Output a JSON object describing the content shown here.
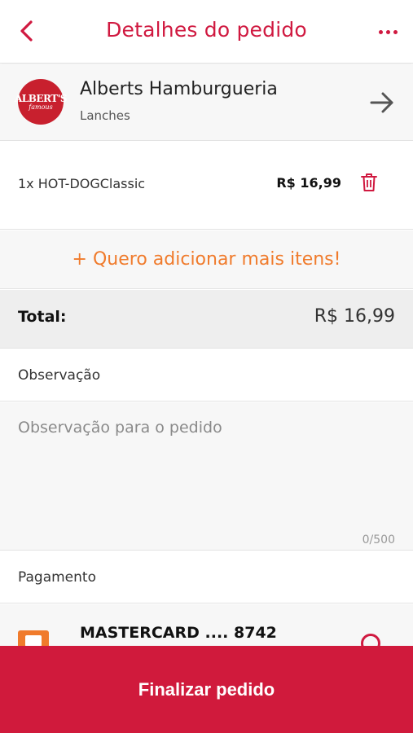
{
  "header": {
    "title": "Detalhes do pedido",
    "back_icon": "chevron-left-icon",
    "more_icon": "more-horizontal-icon"
  },
  "store": {
    "name": "Alberts Hamburgueria",
    "category": "Lanches",
    "logo_text_main": "ALBERT'S",
    "logo_text_sub": "famous",
    "arrow_icon": "arrow-right-icon"
  },
  "items": [
    {
      "label": "1x HOT-DOGClassic",
      "price": "R$ 16,99"
    }
  ],
  "add_more": {
    "label": "+ Quero adicionar mais itens!"
  },
  "total": {
    "label": "Total:",
    "value": "R$ 16,99"
  },
  "observation": {
    "label": "Observação",
    "placeholder": "Observação para o pedido",
    "value": "",
    "counter": "0/500"
  },
  "payment": {
    "label": "Pagamento",
    "method": "MASTERCARD .... 8742"
  },
  "finish": {
    "label": "Finalizar pedido"
  },
  "colors": {
    "accent": "#d01940",
    "orange": "#f07b2c",
    "finish_button": "#d01a3c"
  }
}
